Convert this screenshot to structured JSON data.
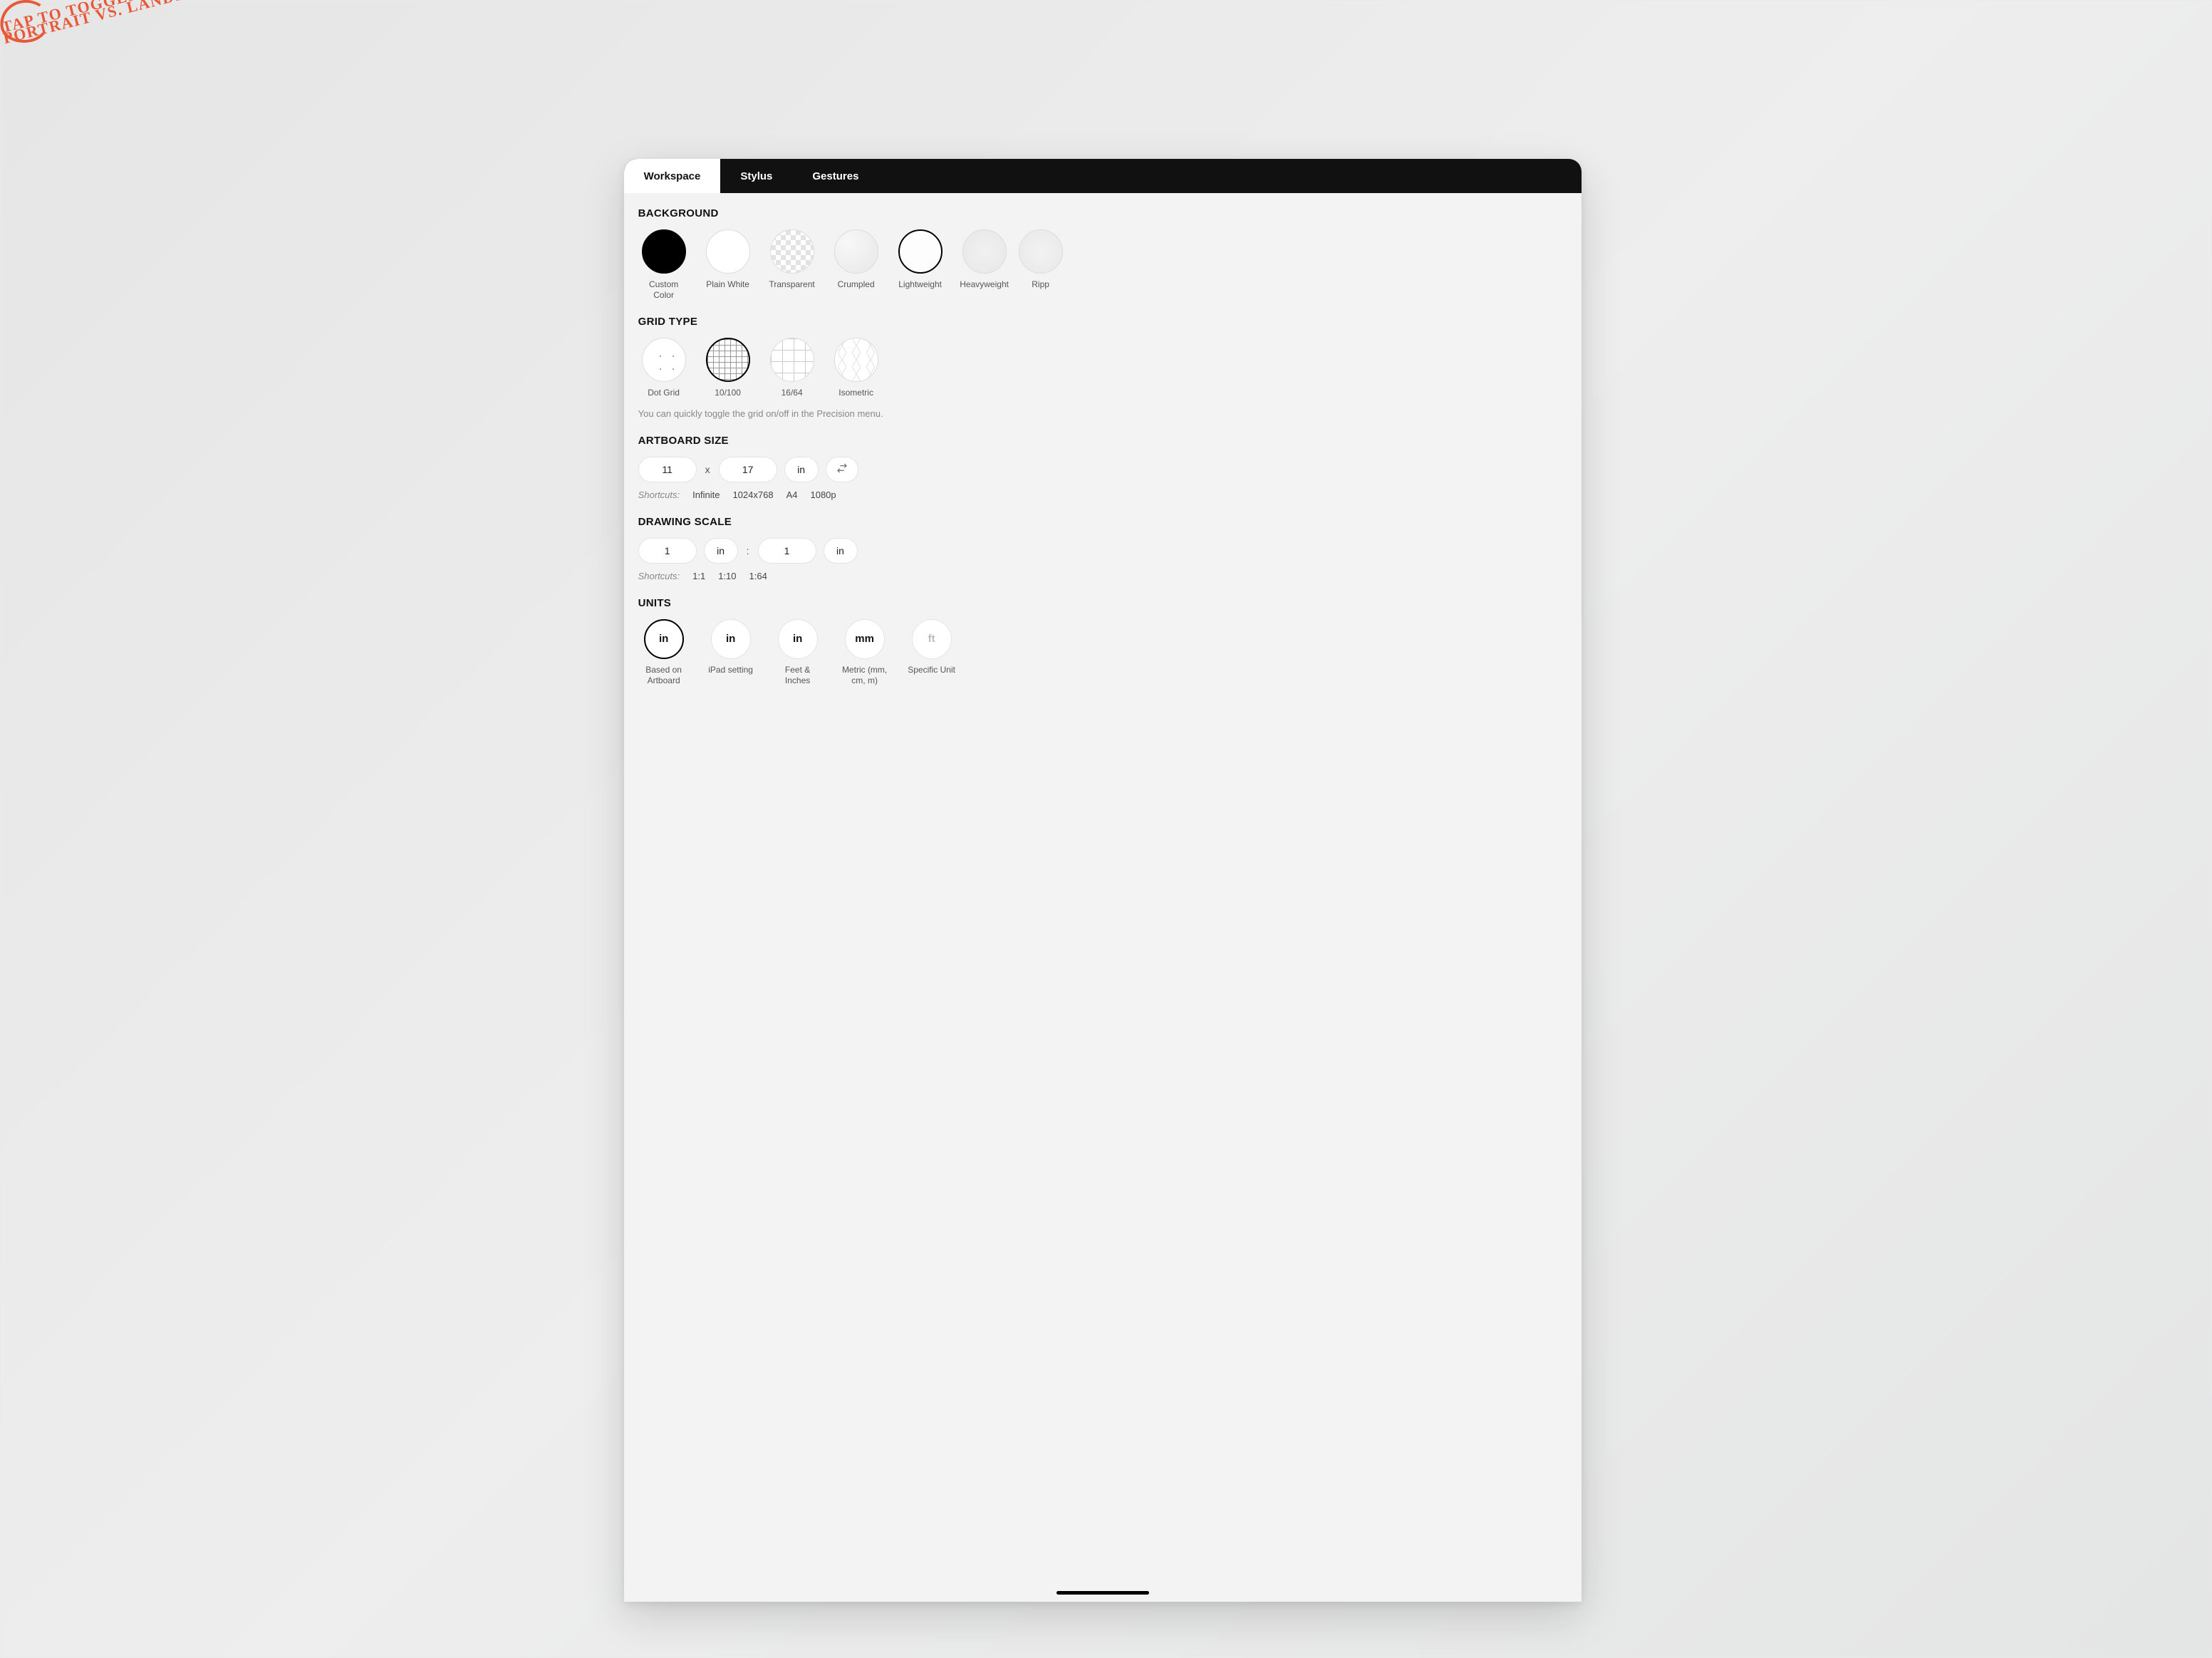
{
  "tabs": {
    "workspace": "Workspace",
    "stylus": "Stylus",
    "gestures": "Gestures"
  },
  "background": {
    "title": "BACKGROUND",
    "items": [
      {
        "label": "Custom Color"
      },
      {
        "label": "Plain White"
      },
      {
        "label": "Transparent"
      },
      {
        "label": "Crumpled"
      },
      {
        "label": "Lightweight"
      },
      {
        "label": "Heavyweight"
      },
      {
        "label": "Ripp"
      }
    ]
  },
  "grid": {
    "title": "GRID TYPE",
    "items": [
      {
        "label": "Dot Grid"
      },
      {
        "label": "10/100"
      },
      {
        "label": "16/64"
      },
      {
        "label": "Isometric"
      }
    ],
    "hint": "You can quickly toggle the grid on/off in the Precision menu."
  },
  "artboard": {
    "title": "ARTBOARD SIZE",
    "width": "11",
    "sep": "x",
    "height": "17",
    "unit": "in",
    "shortcuts_label": "Shortcuts:",
    "shortcuts": [
      "Infinite",
      "1024x768",
      "A4",
      "1080p"
    ]
  },
  "scale": {
    "title": "DRAWING SCALE",
    "left_val": "1",
    "left_unit": "in",
    "sep": ":",
    "right_val": "1",
    "right_unit": "in",
    "shortcuts_label": "Shortcuts:",
    "shortcuts": [
      "1:1",
      "1:10",
      "1:64"
    ]
  },
  "units": {
    "title": "UNITS",
    "items": [
      {
        "abbr": "in",
        "label": "Based on Artboard"
      },
      {
        "abbr": "in",
        "label": "iPad setting"
      },
      {
        "abbr": "in",
        "label": "Feet & Inches"
      },
      {
        "abbr": "mm",
        "label": "Metric (mm, cm, m)"
      },
      {
        "abbr": "ft",
        "label": "Specific Unit"
      }
    ]
  },
  "annotation": {
    "line1": "Tap to toggle",
    "line2": "portrait vs. landscape"
  }
}
